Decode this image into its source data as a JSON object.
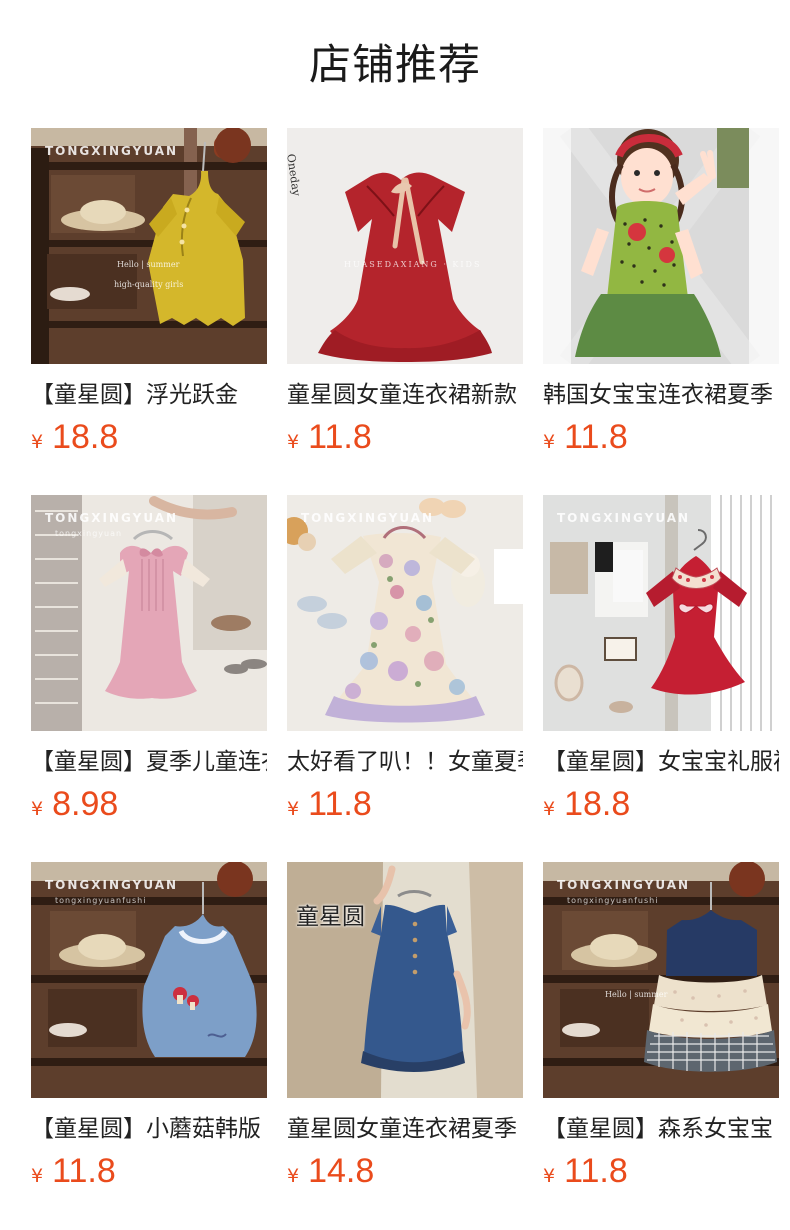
{
  "shop_section": {
    "title": "店铺推荐"
  },
  "products": [
    {
      "name": "【童星圆】浮光跃金",
      "currency": "¥",
      "price": "18.8",
      "image_watermark": "TONGXINGYUAN",
      "image_label_1": "Hello | summer",
      "image_label_2": "high-quality girls"
    },
    {
      "name": "童星圆女童连衣裙新款",
      "currency": "¥",
      "price": "11.8",
      "image_watermark": "HUASEDAXIANG · KIDS",
      "image_label_1": "Oneday"
    },
    {
      "name": "韩国女宝宝连衣裙夏季",
      "currency": "¥",
      "price": "11.8"
    },
    {
      "name": "【童星圆】夏季儿童连衣裙",
      "currency": "¥",
      "price": "8.98",
      "image_watermark": "TONGXINGYUAN",
      "image_label_1": "tongxingyuan"
    },
    {
      "name": "太好看了叭！！女童夏季",
      "currency": "¥",
      "price": "11.8",
      "image_watermark": "TONGXINGYUAN"
    },
    {
      "name": "【童星圆】女宝宝礼服裙",
      "currency": "¥",
      "price": "18.8",
      "image_watermark": "TONGXINGYUAN"
    },
    {
      "name": "【童星圆】小蘑菇韩版",
      "currency": "¥",
      "price": "11.8",
      "image_watermark": "TONGXINGYUAN",
      "image_label_1": "tongxingyuanfushi"
    },
    {
      "name": "童星圆女童连衣裙夏季",
      "currency": "¥",
      "price": "14.8",
      "image_watermark": "童星圆"
    },
    {
      "name": "【童星圆】森系女宝宝",
      "currency": "¥",
      "price": "11.8",
      "image_watermark": "TONGXINGYUAN",
      "image_label_1": "tongxingyuanfushi",
      "image_label_2": "Hello | summer"
    }
  ],
  "colors": {
    "price": "#ea4b1c",
    "title": "#1a1a1a"
  }
}
